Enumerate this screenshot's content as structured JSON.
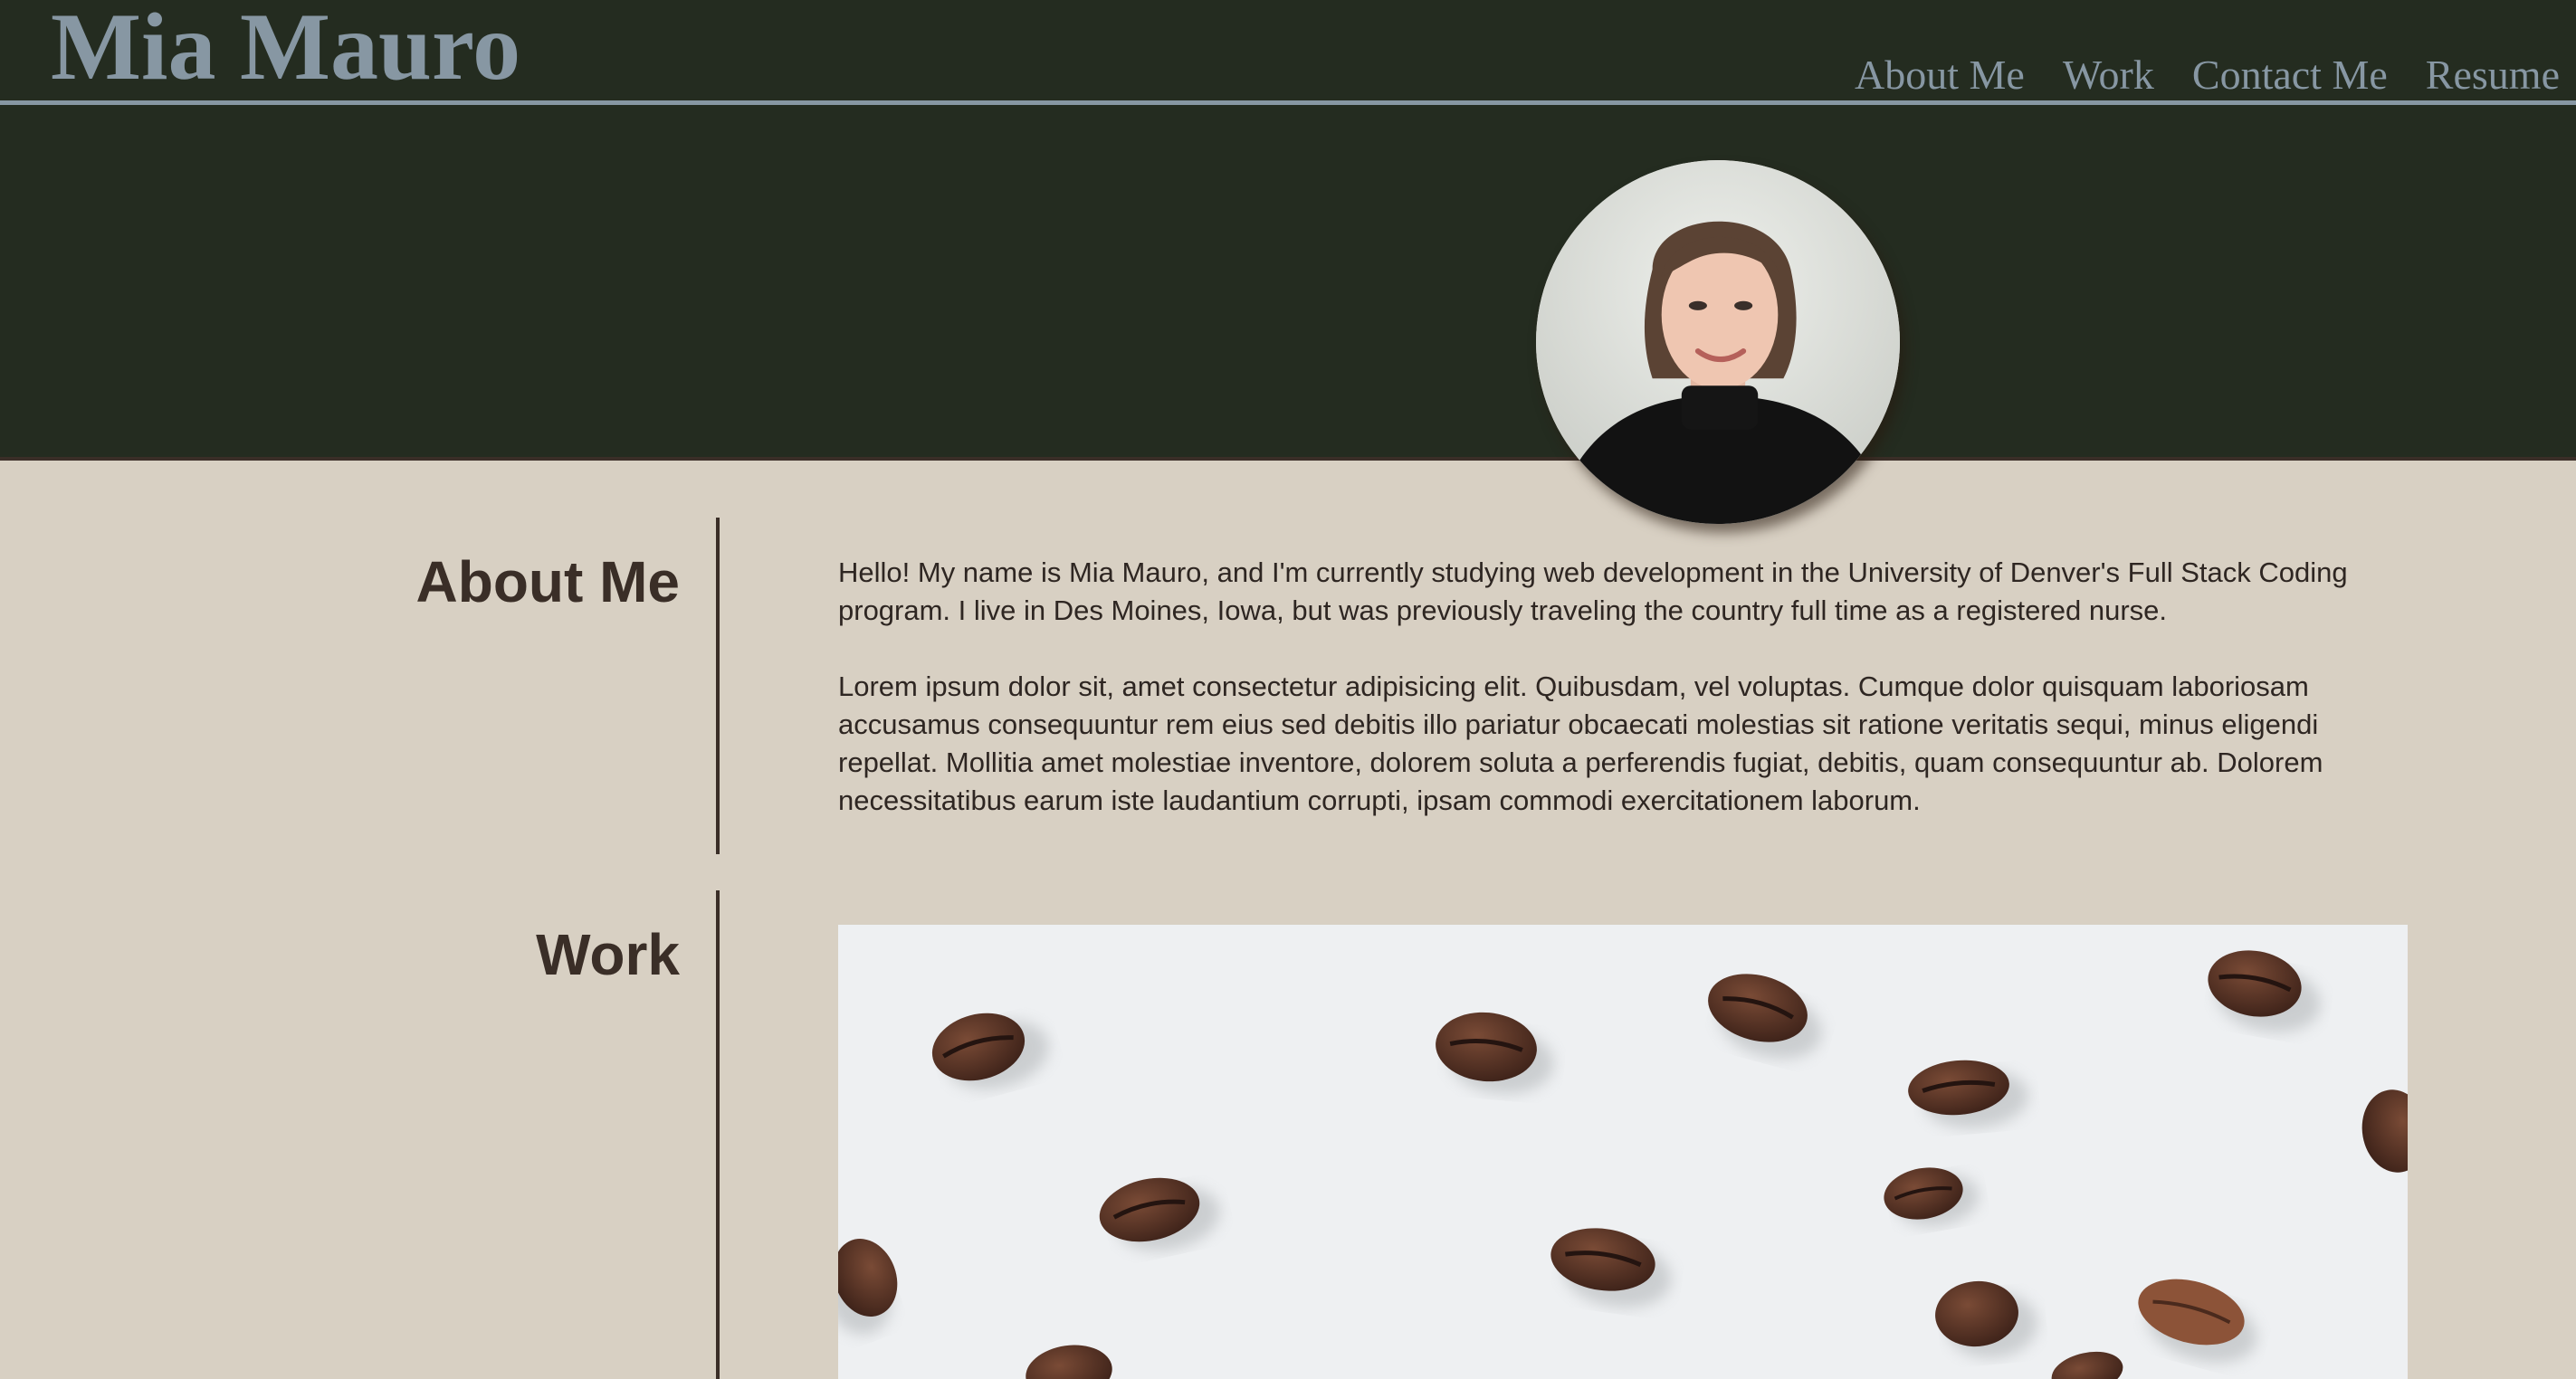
{
  "header": {
    "title": "Mia Mauro",
    "nav": [
      "About Me",
      "Work",
      "Contact Me",
      "Resume"
    ]
  },
  "hero": {
    "avatar_alt": "portrait photo"
  },
  "about": {
    "heading": "About Me",
    "paragraphs": [
      "Hello! My name is Mia Mauro, and I'm currently studying web development in the University of Denver's Full Stack Coding program. I live in Des Moines, Iowa, but was previously traveling the country full time as a registered nurse.",
      "Lorem ipsum dolor sit, amet consectetur adipisicing elit. Quibusdam, vel voluptas. Cumque dolor quisquam laboriosam accusamus consequuntur rem eius sed debitis illo pariatur obcaecati molestias sit ratione veritatis sequi, minus eligendi repellat. Mollitia amet molestiae inventore, dolorem soluta a perferendis fugiat, debitis, quam consequuntur ab. Dolorem necessitatibus earum iste laudantium corrupti, ipsam commodi exercitationem laborum."
    ]
  },
  "work": {
    "heading": "Work",
    "image_alt": "coffee beans project image"
  },
  "colors": {
    "header_bg": "#242c20",
    "accent": "#8797a3",
    "page_bg": "#d8d0c3",
    "text": "#3a2e27"
  }
}
